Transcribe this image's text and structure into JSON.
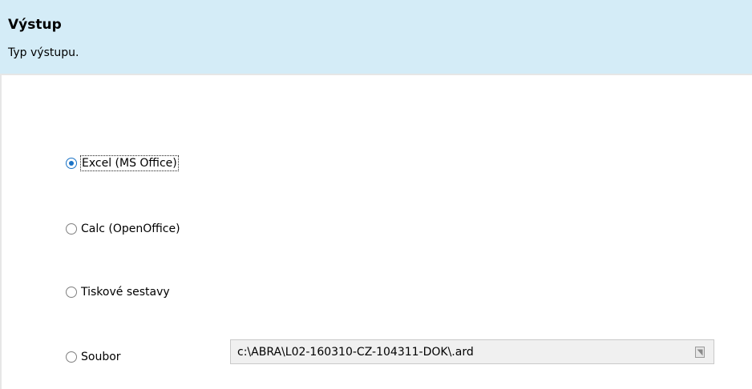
{
  "header": {
    "title": "Výstup",
    "subtitle": "Typ výstupu."
  },
  "output_options": [
    {
      "label": "Excel (MS Office)",
      "selected": true
    },
    {
      "label": "Calc (OpenOffice)",
      "selected": false
    },
    {
      "label": "Tiskové sestavy",
      "selected": false
    },
    {
      "label": "Soubor",
      "selected": false
    }
  ],
  "file": {
    "path": "c:\\ABRA\\L02-160310-CZ-104311-DOK\\.ard",
    "browse_icon": "folder-browse-icon"
  },
  "colors": {
    "header_bg": "#d4ecf7",
    "radio_accent": "#1a73c6",
    "disabled_field_bg": "#f0f0f0"
  }
}
